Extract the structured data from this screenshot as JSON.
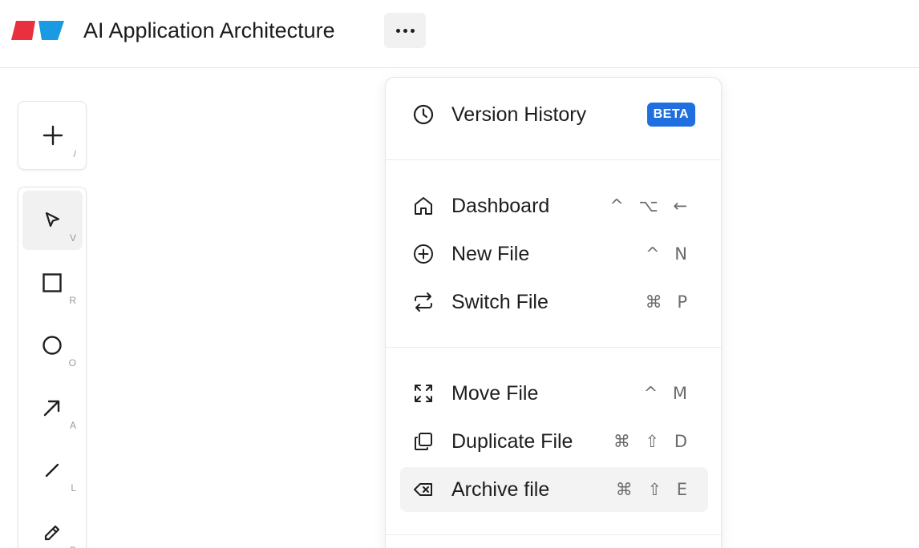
{
  "header": {
    "title": "AI Application Architecture",
    "logo_colors": [
      "#e8303f",
      "#1b9ae4"
    ],
    "more_icon": "more-horizontal-icon"
  },
  "toolbar": {
    "add": {
      "icon": "plus-icon",
      "shortcut": "/"
    },
    "tools": [
      {
        "name": "select",
        "icon": "cursor-arrow-icon",
        "shortcut": "V",
        "active": true
      },
      {
        "name": "rectangle",
        "icon": "square-icon",
        "shortcut": "R"
      },
      {
        "name": "ellipse",
        "icon": "circle-icon",
        "shortcut": "O"
      },
      {
        "name": "arrow",
        "icon": "arrow-up-right-icon",
        "shortcut": "A"
      },
      {
        "name": "line",
        "icon": "line-icon",
        "shortcut": "L"
      },
      {
        "name": "pencil",
        "icon": "pencil-icon",
        "shortcut": "P"
      }
    ]
  },
  "menu": {
    "version_history": {
      "label": "Version History",
      "badge": "BETA",
      "icon": "clock-icon",
      "badge_color": "#1f6fe0"
    },
    "group1": [
      {
        "label": "Dashboard",
        "shortcut": "^ ⌥ ←",
        "icon": "home-icon"
      },
      {
        "label": "New File",
        "shortcut": "^ N",
        "icon": "plus-circle-icon"
      },
      {
        "label": "Switch File",
        "shortcut": "⌘ P",
        "icon": "switch-arrows-icon"
      }
    ],
    "group2": [
      {
        "label": "Move File",
        "shortcut": "^ M",
        "icon": "move-expand-icon"
      },
      {
        "label": "Duplicate File",
        "shortcut": "⌘ ⇧ D",
        "icon": "duplicate-icon"
      },
      {
        "label": "Archive file",
        "shortcut": "⌘ ⇧ E",
        "icon": "archive-delete-icon",
        "highlighted": true
      }
    ]
  }
}
